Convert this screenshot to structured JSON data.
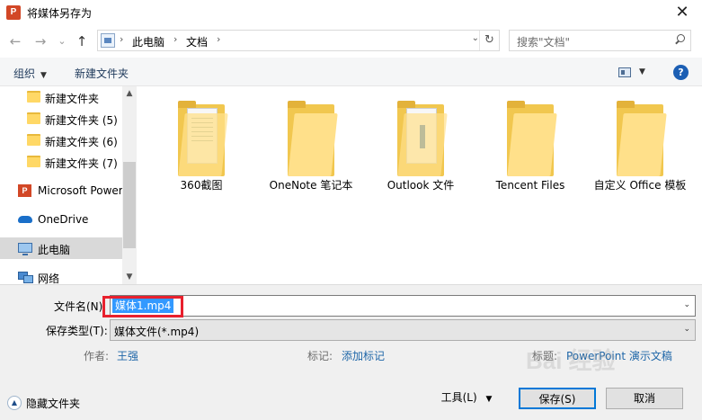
{
  "window": {
    "title": "将媒体另存为",
    "close_glyph": "✕",
    "app_icon": "P"
  },
  "nav": {
    "back_glyph": "←",
    "forward_glyph": "→",
    "recent_glyph": "⌄",
    "up_glyph": "↑",
    "breadcrumbs": [
      "此电脑",
      "文档"
    ],
    "sep": "›",
    "refresh_glyph": "↻",
    "dropdown_glyph": "⌄",
    "search_placeholder": "搜索\"文档\""
  },
  "toolbar": {
    "organize_label": "组织",
    "new_folder_label": "新建文件夹",
    "help_glyph": "?",
    "caret": "▼"
  },
  "sidebar": {
    "items": [
      {
        "label": "新建文件夹",
        "icon": "folder-icon"
      },
      {
        "label": "新建文件夹 (5)",
        "icon": "folder-icon"
      },
      {
        "label": "新建文件夹 (6)",
        "icon": "folder-icon"
      },
      {
        "label": "新建文件夹 (7)",
        "icon": "folder-icon"
      },
      {
        "label": "Microsoft Power",
        "icon": "powerpoint-icon"
      },
      {
        "label": "OneDrive",
        "icon": "cloud-icon"
      },
      {
        "label": "此电脑",
        "icon": "computer-icon",
        "selected": true
      },
      {
        "label": "网络",
        "icon": "network-icon"
      }
    ],
    "ppt_glyph": "P",
    "scroll_up": "▲",
    "scroll_down": "▼"
  },
  "content": {
    "items": [
      {
        "label": "360截图"
      },
      {
        "label": "OneNote 笔记本"
      },
      {
        "label": "Outlook 文件"
      },
      {
        "label": "Tencent Files"
      },
      {
        "label": "自定义 Office 模板"
      }
    ]
  },
  "form": {
    "filename_label": "文件名(N):",
    "filename_value": "媒体1.mp4",
    "filetype_label": "保存类型(T):",
    "filetype_value": "媒体文件(*.mp4)",
    "dropdown_glyph": "⌄",
    "author_label": "作者:",
    "author_value": "王强",
    "tags_label": "标记:",
    "tags_value": "添加标记",
    "title_label": "标题:",
    "title_value": "PowerPoint 演示文稿"
  },
  "footer": {
    "hide_folders_label": "隐藏文件夹",
    "hide_glyph": "▲",
    "tools_label": "工具(L)",
    "tools_caret": "▼",
    "save_label": "保存(S)",
    "cancel_label": "取消"
  },
  "watermark": "Bai 经验"
}
